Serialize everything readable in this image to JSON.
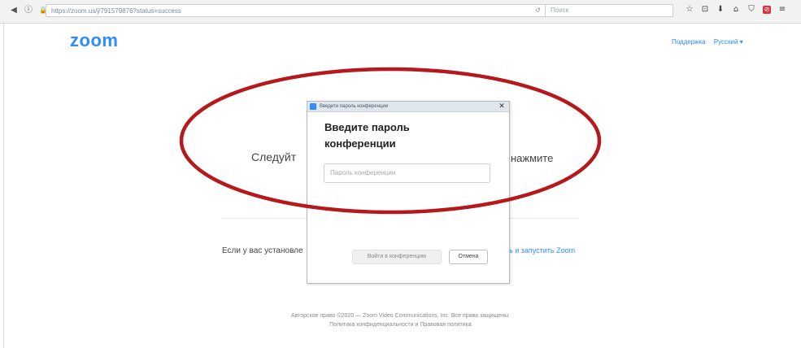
{
  "browser": {
    "nav_back": "◀",
    "nav_info": "ⓘ",
    "nav_lock": "🔒",
    "url": "https://zoom.us/j/791579876?status=success",
    "url_tools": "↺",
    "search_placeholder": "Поиск",
    "toolbar_icons": [
      "☆",
      "⊡",
      "⬇",
      "⌂",
      "⛉",
      "⊘",
      "≡"
    ]
  },
  "header": {
    "logo": "zoom",
    "support_link": "Поддержка",
    "language_link": "Русский ▾"
  },
  "main": {
    "instruction_left": "Следуйт",
    "instruction_right": "нажмите",
    "installed_left": "Если у вас установле",
    "installed_right": "ь и запустить Zoom"
  },
  "footer": {
    "copyright": "Авторское право ©2020 — Zoom Video Communications, Inc. Все права защищены.",
    "policy": "Политика конфиденциальности и Правовая политика"
  },
  "dialog": {
    "window_title": "Введите пароль конференции",
    "close": "✕",
    "heading_line1": "Введите пароль",
    "heading_line2": "конференции",
    "password_placeholder": "Пароль конференции",
    "join_button": "Войти в конференцию",
    "cancel_button": "Отмена"
  },
  "colors": {
    "brand": "#2d8cff",
    "annotation": "#b5191c"
  }
}
